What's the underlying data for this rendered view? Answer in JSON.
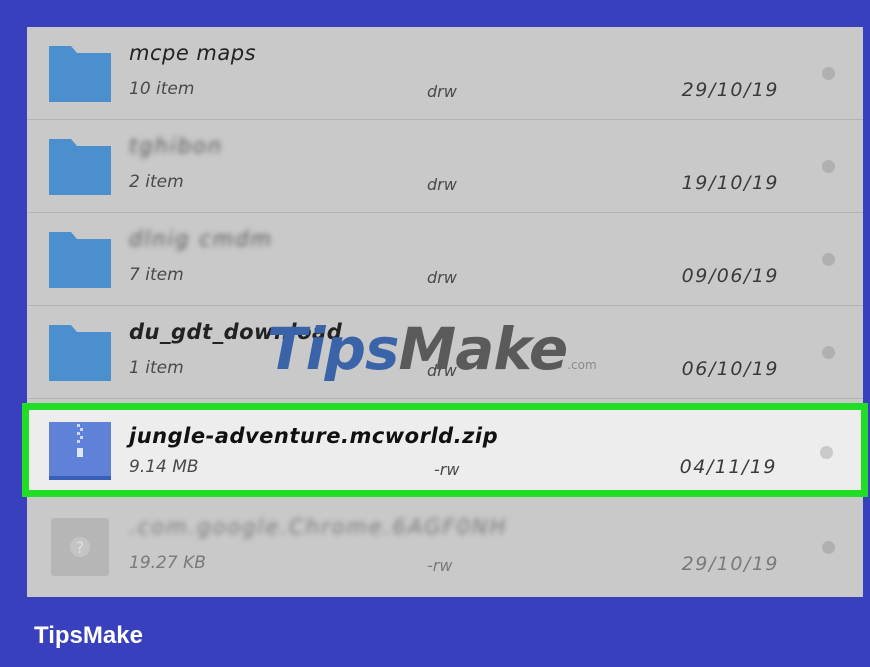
{
  "files": [
    {
      "name": "mcpe maps",
      "sub": "10 item",
      "perm": "drw",
      "date": "29/10/19",
      "type": "folder-icon"
    },
    {
      "name": "tghibon",
      "sub": "2 item",
      "perm": "drw",
      "date": "19/10/19",
      "type": "folder-icon"
    },
    {
      "name": "dlnig cmdm",
      "sub": "7 item",
      "perm": "drw",
      "date": "09/06/19",
      "type": "folder-icon"
    },
    {
      "name": "du_gdt_download",
      "sub": "1 item",
      "perm": "drw",
      "date": "06/10/19",
      "type": "folder-icon"
    },
    {
      "name": "jungle-adventure.mcworld.zip",
      "sub": "9.14 MB",
      "perm": "-rw",
      "date": "04/11/19",
      "type": "zip-file-icon"
    },
    {
      "name": ".com.google.Chrome.6AGF0NH",
      "sub": "19.27 KB",
      "perm": "-rw",
      "date": "29/10/19",
      "type": "unknown-file-icon"
    }
  ],
  "watermark": {
    "tips": "Tips",
    "make": "Make",
    "com": ".com"
  },
  "brand": "TipsMake",
  "colors": {
    "background": "#3840bd",
    "highlight_border": "#21dd26",
    "folder": "#4b8fcf"
  }
}
